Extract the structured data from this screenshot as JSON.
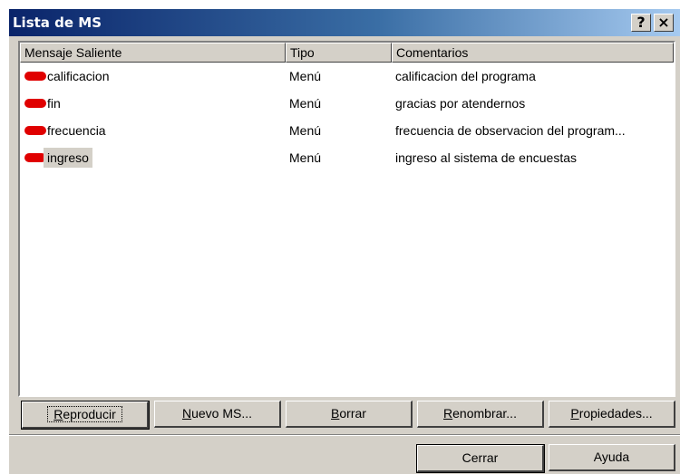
{
  "window": {
    "title": "Lista de MS",
    "help_button": "?",
    "close_button": "×"
  },
  "list": {
    "columns": [
      "Mensaje Saliente",
      "Tipo",
      "Comentarios"
    ],
    "rows": [
      {
        "name": "calificacion",
        "type": "Menú",
        "comment": "calificacion del programa",
        "icon": "red-message-icon"
      },
      {
        "name": "fin",
        "type": "Menú",
        "comment": "gracias por atendernos",
        "icon": "red-message-icon"
      },
      {
        "name": "frecuencia",
        "type": "Menú",
        "comment": "frecuencia de observacion del program...",
        "icon": "red-message-icon"
      },
      {
        "name": "ingreso",
        "type": "Menú",
        "comment": "ingreso al sistema de encuestas",
        "icon": "red-message-icon",
        "selected": true
      }
    ]
  },
  "actions": {
    "reproducir": {
      "mnemonic": "R",
      "rest": "eproducir"
    },
    "nuevo": {
      "mnemonic": "N",
      "rest": "uevo MS..."
    },
    "borrar": {
      "mnemonic": "B",
      "rest": "orrar"
    },
    "renombrar": {
      "mnemonic": "R",
      "rest": "enombrar..."
    },
    "propiedades": {
      "mnemonic": "P",
      "rest": "ropiedades..."
    }
  },
  "footer": {
    "close_label": "Cerrar",
    "help_label": "Ayuda"
  },
  "colors": {
    "dialog_face": "#d4d0c8",
    "title_gradient_start": "#0a246a",
    "icon_red": "#e00000"
  }
}
